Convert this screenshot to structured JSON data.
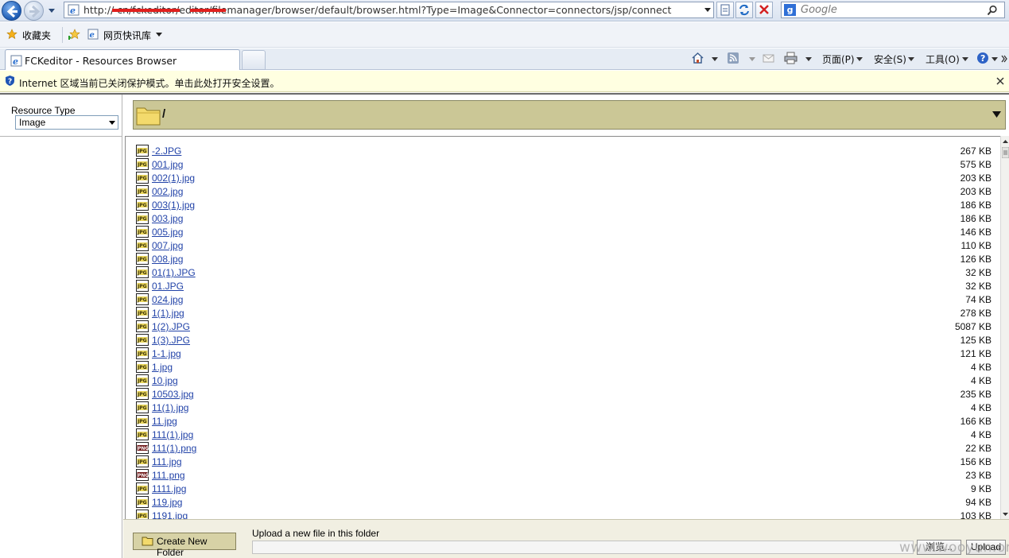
{
  "browser": {
    "url": "http://              cn/fckeditor/editor/filemanager/browser/default/browser.html?Type=Image&Connector=connectors/jsp/connect",
    "search_placeholder": "Google",
    "favorites_label": "收藏夹",
    "quick_links_label": "网页快讯库",
    "tab_title": "FCKeditor - Resources Browser",
    "command_menus": {
      "page": "页面(P)",
      "safety": "安全(S)",
      "tools": "工具(O)"
    },
    "info_bar_text": "Internet 区域当前已关闭保护模式。单击此处打开安全设置。"
  },
  "sidebar": {
    "resource_type_label": "Resource Type",
    "resource_type_value": "Image"
  },
  "folder": {
    "path": "/"
  },
  "files": [
    {
      "name": "-2.JPG",
      "size": "267 KB",
      "type": "jpg"
    },
    {
      "name": "001.jpg",
      "size": "575 KB",
      "type": "jpg"
    },
    {
      "name": "002(1).jpg",
      "size": "203 KB",
      "type": "jpg"
    },
    {
      "name": "002.jpg",
      "size": "203 KB",
      "type": "jpg"
    },
    {
      "name": "003(1).jpg",
      "size": "186 KB",
      "type": "jpg"
    },
    {
      "name": "003.jpg",
      "size": "186 KB",
      "type": "jpg"
    },
    {
      "name": "005.jpg",
      "size": "146 KB",
      "type": "jpg"
    },
    {
      "name": "007.jpg",
      "size": "110 KB",
      "type": "jpg"
    },
    {
      "name": "008.jpg",
      "size": "126 KB",
      "type": "jpg"
    },
    {
      "name": "01(1).JPG",
      "size": "32 KB",
      "type": "jpg"
    },
    {
      "name": "01.JPG",
      "size": "32 KB",
      "type": "jpg"
    },
    {
      "name": "024.jpg",
      "size": "74 KB",
      "type": "jpg"
    },
    {
      "name": "1(1).jpg",
      "size": "278 KB",
      "type": "jpg"
    },
    {
      "name": "1(2).JPG",
      "size": "5087 KB",
      "type": "jpg"
    },
    {
      "name": "1(3).JPG",
      "size": "125 KB",
      "type": "jpg"
    },
    {
      "name": "1-1.jpg",
      "size": "121 KB",
      "type": "jpg"
    },
    {
      "name": "1.jpg",
      "size": "4 KB",
      "type": "jpg"
    },
    {
      "name": "10.jpg",
      "size": "4 KB",
      "type": "jpg"
    },
    {
      "name": "10503.jpg",
      "size": "235 KB",
      "type": "jpg"
    },
    {
      "name": "11(1).jpg",
      "size": "4 KB",
      "type": "jpg"
    },
    {
      "name": "11.jpg",
      "size": "166 KB",
      "type": "jpg"
    },
    {
      "name": "111(1).jpg",
      "size": "4 KB",
      "type": "jpg"
    },
    {
      "name": "111(1).png",
      "size": "22 KB",
      "type": "png"
    },
    {
      "name": "111.jpg",
      "size": "156 KB",
      "type": "jpg"
    },
    {
      "name": "111.png",
      "size": "23 KB",
      "type": "png"
    },
    {
      "name": "1111.jpg",
      "size": "9 KB",
      "type": "jpg"
    },
    {
      "name": "119.jpg",
      "size": "94 KB",
      "type": "jpg"
    },
    {
      "name": "1191.jpg",
      "size": "103 KB",
      "type": "jpg"
    }
  ],
  "icon_labels": {
    "jpg": "JPG",
    "png": "PNG"
  },
  "upload": {
    "create_folder_label": "Create New Folder",
    "upload_label": "Upload a new file in this folder",
    "browse_label": "浏览...",
    "upload_button_label": "Upload"
  },
  "watermark": "www.wooyun.org"
}
